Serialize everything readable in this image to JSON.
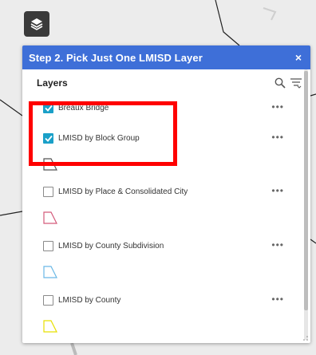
{
  "panel": {
    "title": "Step 2. Pick Just One LMISD Layer",
    "close_label": "×"
  },
  "layers_header": {
    "title": "Layers"
  },
  "layers": [
    {
      "label": "Breaux Bridge",
      "checked": true,
      "expanded": false,
      "swatch": null
    },
    {
      "label": "LMISD by Block Group",
      "checked": true,
      "expanded": true,
      "swatch": "#555555"
    },
    {
      "label": "LMISD by Place & Consolidated City",
      "checked": false,
      "expanded": true,
      "swatch": "#d45a7a"
    },
    {
      "label": "LMISD by County Subdivision",
      "checked": false,
      "expanded": true,
      "swatch": "#6ab8e6"
    },
    {
      "label": "LMISD by County",
      "checked": false,
      "expanded": true,
      "swatch": "#e8e000"
    }
  ],
  "more_label": "•••",
  "colors": {
    "header": "#3e6fd8",
    "checkbox_on": "#1aa0c8",
    "highlight": "#ff0000"
  }
}
